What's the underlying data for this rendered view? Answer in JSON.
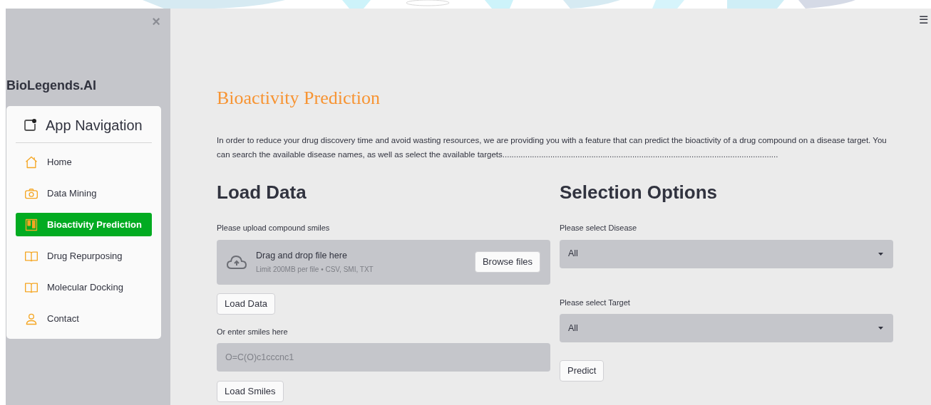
{
  "sidebar": {
    "close": "×",
    "brand": "BioLegends.AI",
    "nav": {
      "title": "App Navigation",
      "items": [
        {
          "label": "Home",
          "selected": false
        },
        {
          "label": "Data Mining",
          "selected": false
        },
        {
          "label": "Bioactivity Prediction",
          "selected": true
        },
        {
          "label": "Drug Repurposing",
          "selected": false
        },
        {
          "label": "Molecular Docking",
          "selected": false
        },
        {
          "label": "Contact",
          "selected": false
        }
      ]
    }
  },
  "menu": "☰",
  "main": {
    "title": "Bioactivity Prediction",
    "intro": "In order to reduce your drug discovery time and avoid wasting resources, we are providing you with a feature that can predict the bioactivity of a drug compound on a disease target. You can search the available disease names, as well as select the available targets.........................................................................................................................",
    "load": {
      "heading": "Load Data",
      "upload_label": "Please upload compound smiles",
      "dropzone": {
        "title": "Drag and drop file here",
        "hint": "Limit 200MB per file • CSV, SMI, TXT",
        "button": "Browse files"
      },
      "load_button": "Load Data",
      "smiles_label": "Or enter smiles here",
      "smiles_field": {
        "placeholder": "O=C(O)c1cccnc1"
      },
      "smiles_button": "Load Smiles"
    },
    "options": {
      "heading": "Selection Options",
      "selects": [
        {
          "label": "Please select Disease",
          "value": "All"
        },
        {
          "label": "Please select Target",
          "value": "All"
        }
      ],
      "predict_button": "Predict"
    }
  }
}
